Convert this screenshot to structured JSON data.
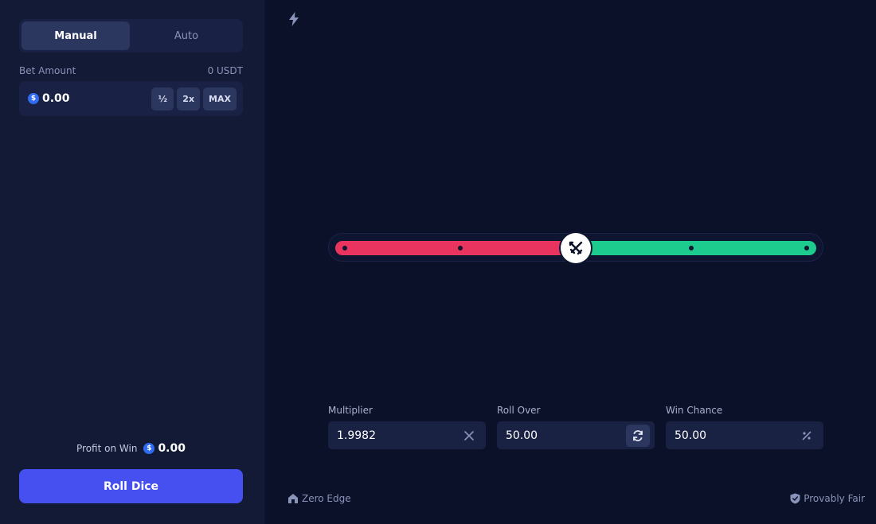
{
  "mode_tabs": [
    {
      "label": "Manual",
      "active": true
    },
    {
      "label": "Auto",
      "active": false
    }
  ],
  "bet": {
    "label": "Bet Amount",
    "balance": "0 USDT",
    "currency_symbol": "$",
    "value": "0.00",
    "half_label": "½",
    "double_label": "2x",
    "max_label": "MAX"
  },
  "profit": {
    "label": "Profit on Win",
    "value": "0.00"
  },
  "roll_button_label": "Roll Dice",
  "slider": {
    "value": 50,
    "min": 0,
    "max": 100,
    "ticks": [
      0,
      25,
      50,
      75,
      100
    ],
    "lose_color": "#e8345f",
    "win_color": "#1ecb8e"
  },
  "fields": {
    "multiplier": {
      "label": "Multiplier",
      "value": "1.9982",
      "icon": "x-icon"
    },
    "roll_over": {
      "label": "Roll Over",
      "value": "50.00",
      "icon": "refresh-icon"
    },
    "win_chance": {
      "label": "Win Chance",
      "value": "50.00",
      "icon": "percent-icon"
    }
  },
  "footer": {
    "zero_edge": "Zero Edge",
    "provably_fair": "Provably Fair"
  },
  "colors": {
    "accent": "#4650f0",
    "coin": "#2f6cf2",
    "background": "#0b1128",
    "panel": "#121a36"
  }
}
